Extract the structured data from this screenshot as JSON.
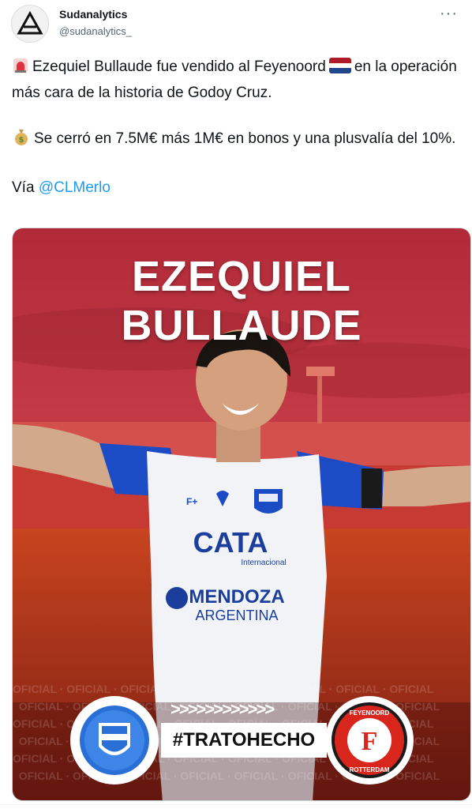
{
  "author": {
    "display_name": "Sudanalytics",
    "handle": "@sudanalytics_",
    "avatar_icon": "triangle-logo-icon"
  },
  "more_icon": "more-options-icon",
  "tweet": {
    "line1_emoji": "police-light-icon",
    "line1_text_a": "Ezequiel Bullaude fue vendido al Feyenoord",
    "line1_flag": "netherlands-flag-icon",
    "line1_text_b": "en la operación más cara de la historia de Godoy Cruz.",
    "line2_emoji": "money-bag-icon",
    "line2_text": "Se cerró en 7.5M€ más 1M€ en bonos y una plusvalía del 10%.",
    "via_label": "Vía",
    "via_mention": "@CLMerlo"
  },
  "image": {
    "player_name": "EZEQUIEL BULLAUDE",
    "shirt_sponsor": "CATA",
    "shirt_sponsor_sub": "Internacional",
    "shirt_second_sponsor": "MENDOZA",
    "shirt_second_sponsor_sub": "ARGENTINA",
    "shirt_brand": "F+",
    "background_word": "OFICIAL",
    "arrows": ">>>>>>>>>>>>",
    "hashtag": "#TRATOHECHO",
    "left_crest": "godoy-cruz-crest-icon",
    "right_crest_top": "FEYENOORD",
    "right_crest_letter": "F",
    "right_crest_bottom": "ROTTERDAM"
  },
  "colors": {
    "mention": "#1d9bf0",
    "bg_red": "#b8303a",
    "pitch_red": "#c2401f",
    "shirt_blue": "#1b4bc5",
    "feyenoord_red": "#d9261c"
  }
}
